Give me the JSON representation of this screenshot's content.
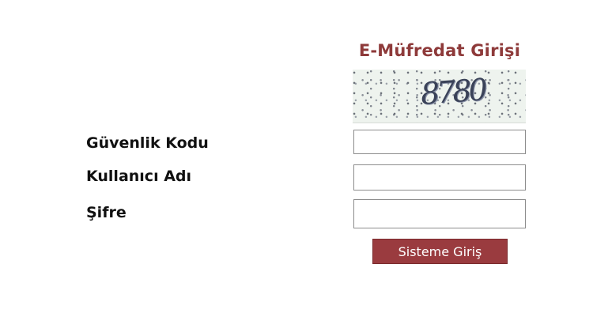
{
  "login": {
    "title": "E-Müfredat Girişi",
    "captcha_text": "8780",
    "fields": [
      {
        "label": "Güvenlik Kodu",
        "value": "",
        "placeholder": ""
      },
      {
        "label": "Kullanıcı Adı",
        "value": "",
        "placeholder": ""
      },
      {
        "label": "Şifre",
        "value": "",
        "placeholder": ""
      }
    ],
    "submit_label": "Sisteme Giriş"
  },
  "colors": {
    "title": "#8e3a3a",
    "button_bg": "#9a3b3f",
    "button_text": "#ffffff",
    "captcha_bg": "#eef3ee"
  }
}
